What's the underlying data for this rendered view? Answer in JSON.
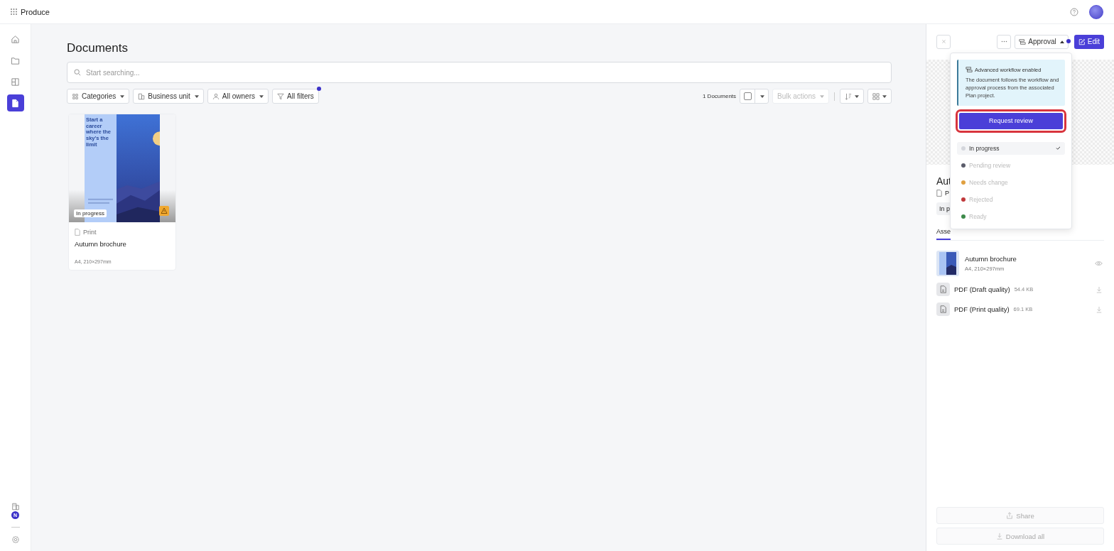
{
  "app": {
    "title": "Produce"
  },
  "sidebar": {
    "items": [
      {
        "selected": false
      },
      {
        "selected": false
      },
      {
        "selected": false
      },
      {
        "selected": true
      }
    ],
    "workspace_badge": "N"
  },
  "page": {
    "title": "Documents",
    "search": {
      "placeholder": "Start searching..."
    },
    "filters": [
      {
        "label": "Categories"
      },
      {
        "label": "Business unit"
      },
      {
        "label": "All owners"
      }
    ],
    "all_filters": {
      "label": "All filters",
      "active": true
    },
    "count": "1 Documents",
    "bulk_actions": {
      "label": "Bulk actions",
      "disabled": true
    }
  },
  "documents": [
    {
      "headline": "Start a career where the sky's the limit",
      "status": "In progress",
      "warning": true,
      "type": "Print",
      "name": "Autumn brochure",
      "size": "A4, 210×297mm"
    }
  ],
  "panel": {
    "title": "Aut",
    "type": "P",
    "status_chip": "In p",
    "tab": "Asse",
    "approval": {
      "label": "Approval",
      "expanded": true,
      "notify": true
    },
    "edit": "Edit",
    "assets": [
      {
        "kind": "thumbnail",
        "name": "Autumn brochure",
        "meta": "A4, 210×297mm"
      },
      {
        "kind": "file",
        "name": "PDF (Draft quality)",
        "meta": "54.4 KB"
      },
      {
        "kind": "file",
        "name": "PDF (Print quality)",
        "meta": "69.1 KB"
      }
    ],
    "share": "Share",
    "download_all": "Download all"
  },
  "popover": {
    "notice_title": "Advanced workflow enabled",
    "notice_text": "The document follows the workflow and approval process from the associated Plan project.",
    "action": "Request review",
    "statuses": [
      {
        "label": "In progress",
        "color": "#d4d6dc",
        "selected": true,
        "disabled": false
      },
      {
        "label": "Pending review",
        "color": "#5b5d6b",
        "selected": false,
        "disabled": true
      },
      {
        "label": "Needs change",
        "color": "#e0a040",
        "selected": false,
        "disabled": true
      },
      {
        "label": "Rejected",
        "color": "#c0393b",
        "selected": false,
        "disabled": true
      },
      {
        "label": "Ready",
        "color": "#3d8a4a",
        "selected": false,
        "disabled": true
      }
    ]
  }
}
